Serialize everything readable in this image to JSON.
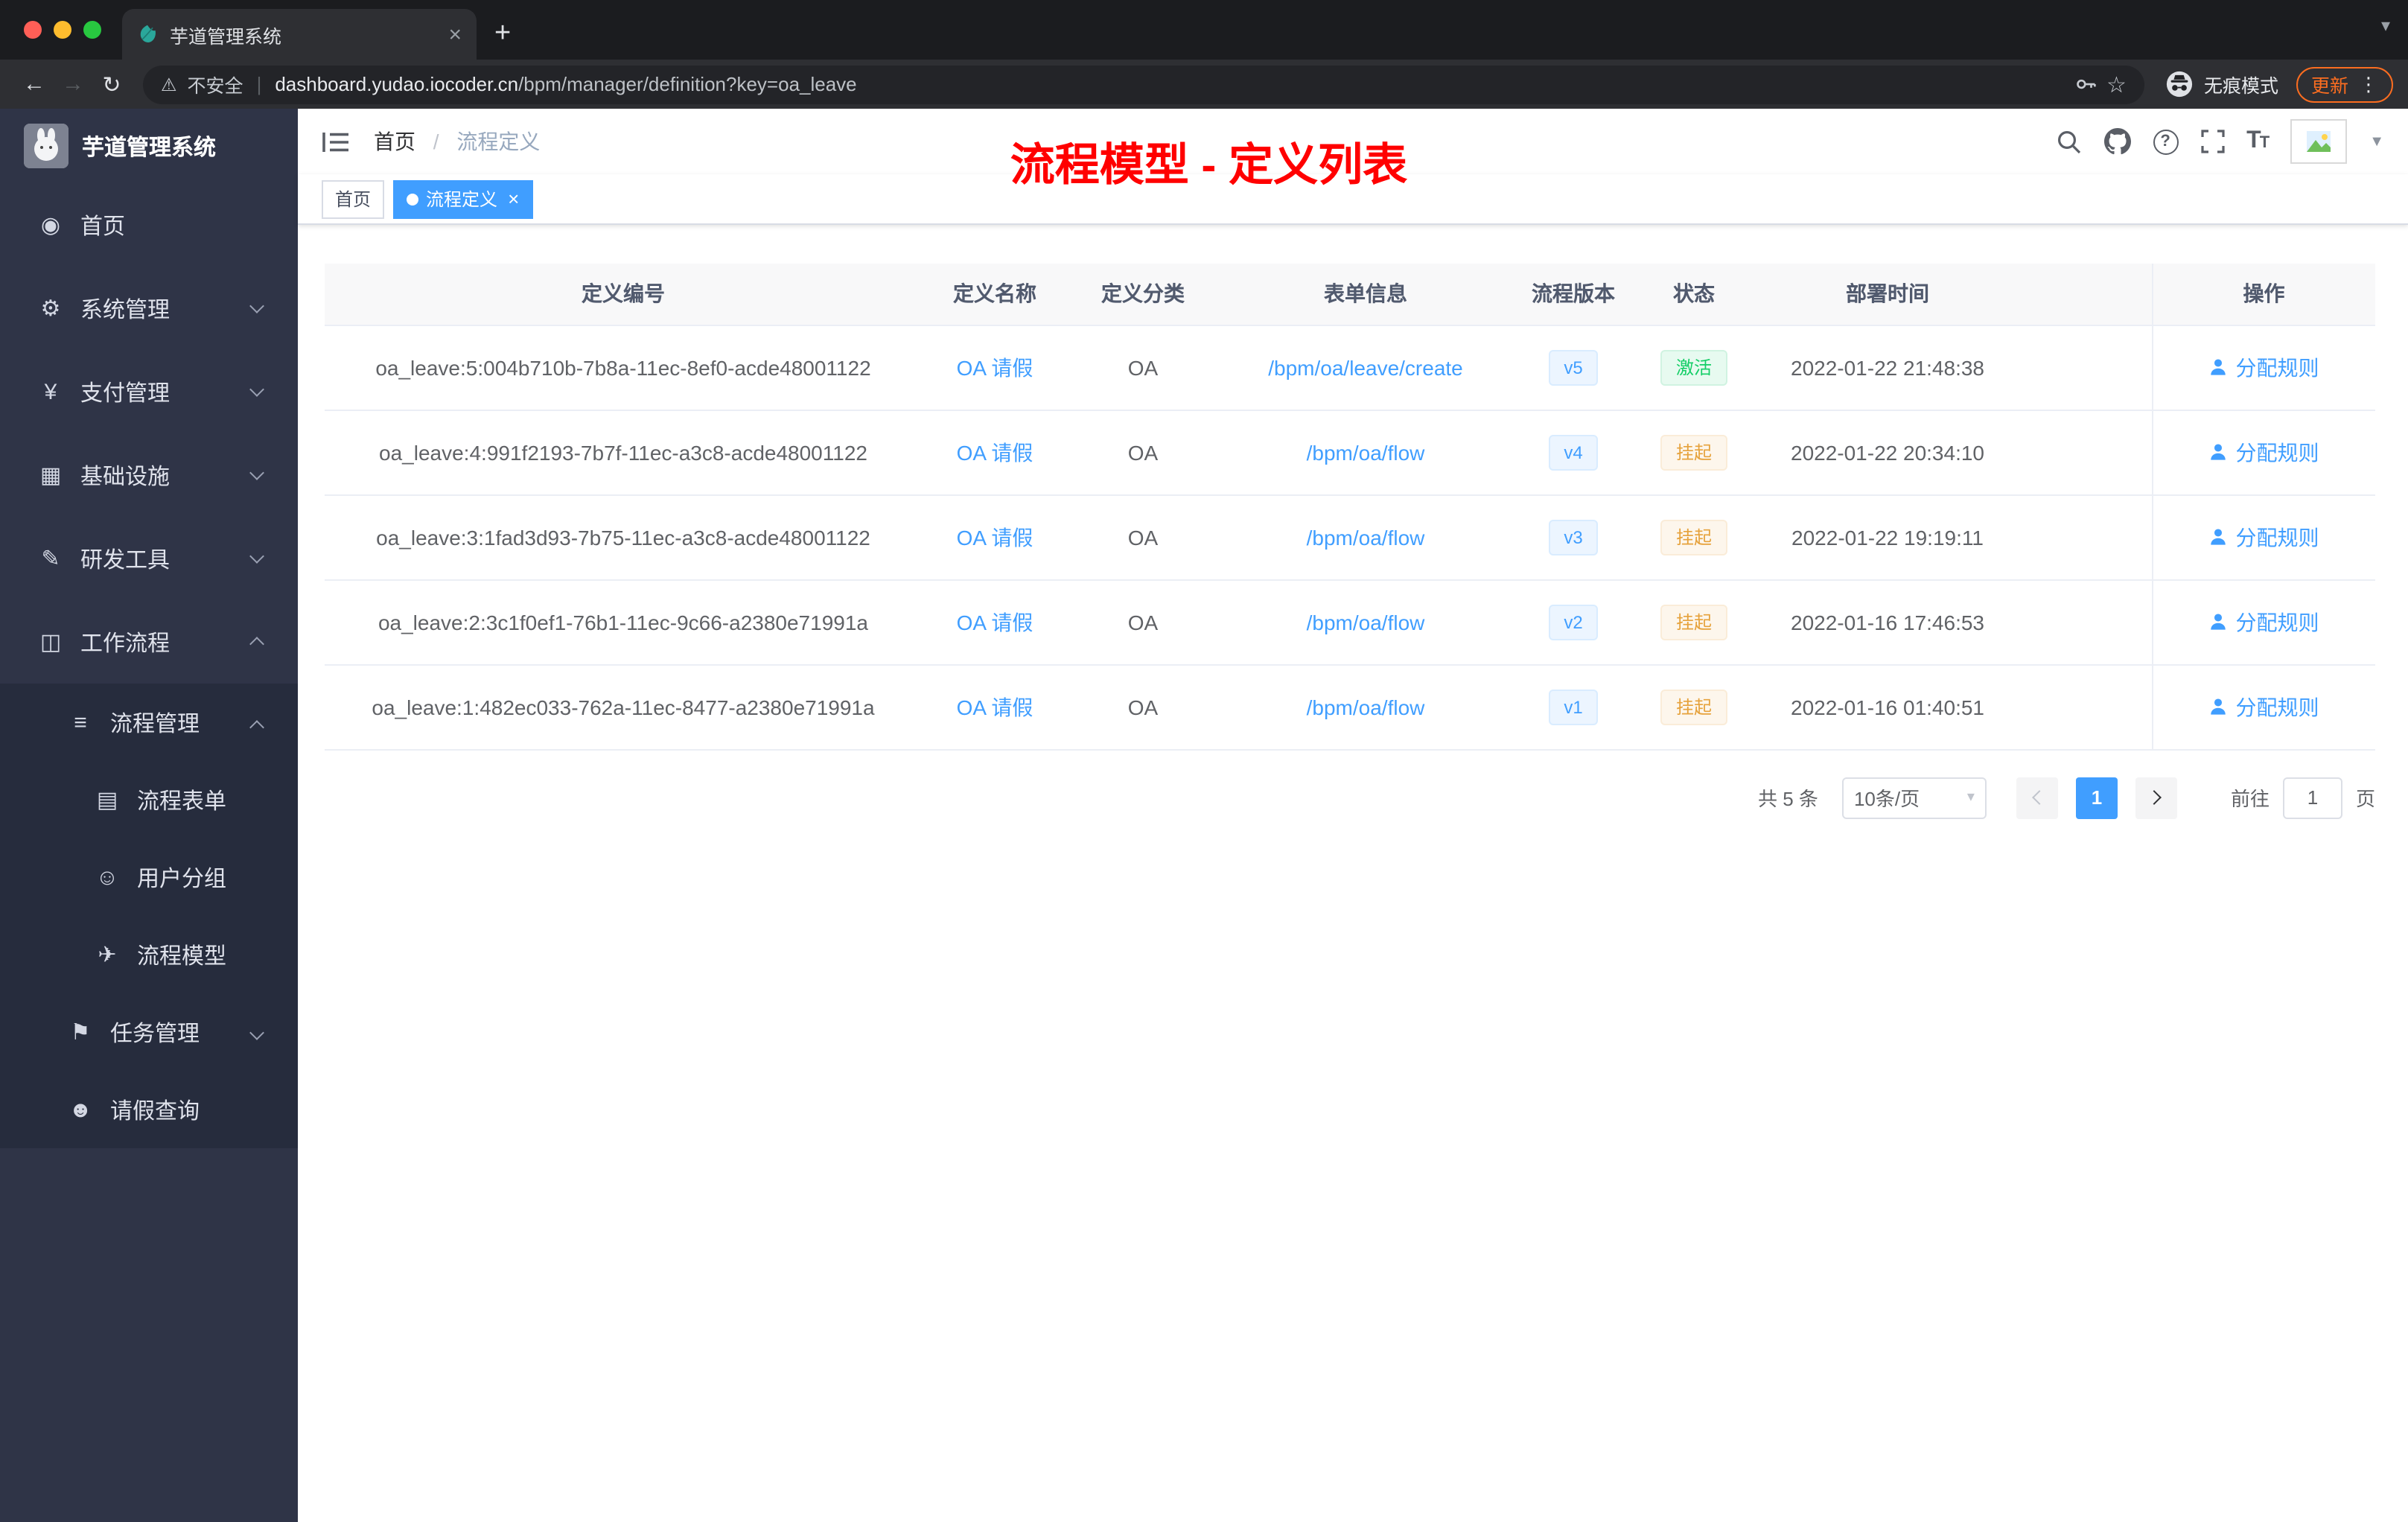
{
  "colors": {
    "accent": "#409eff",
    "success": "#13ce66",
    "warning": "#e6a23c",
    "annotation": "#ff0000",
    "update": "#fb6d20"
  },
  "browser": {
    "tab_title": "芋道管理系统",
    "security_label": "不安全",
    "url_host": "dashboard.yudao.iocoder.cn",
    "url_path": "/bpm/manager/definition?key=oa_leave",
    "incognito_label": "无痕模式",
    "update_label": "更新"
  },
  "sidebar": {
    "logo_title": "芋道管理系统",
    "menu": [
      {
        "id": "home",
        "label": "首页",
        "icon": "dashboard-icon",
        "level": 1,
        "chevron": null,
        "dark": false
      },
      {
        "id": "system-mgmt",
        "label": "系统管理",
        "icon": "gear-icon",
        "level": 1,
        "chevron": "down",
        "dark": false
      },
      {
        "id": "payment-mgmt",
        "label": "支付管理",
        "icon": "yen-icon",
        "level": 1,
        "chevron": "down",
        "dark": false
      },
      {
        "id": "infrastructure",
        "label": "基础设施",
        "icon": "infrastructure-icon",
        "level": 1,
        "chevron": "down",
        "dark": false
      },
      {
        "id": "dev-tools",
        "label": "研发工具",
        "icon": "tools-icon",
        "level": 1,
        "chevron": "down",
        "dark": false
      },
      {
        "id": "workflow",
        "label": "工作流程",
        "icon": "workflow-icon",
        "level": 1,
        "chevron": "up",
        "dark": false
      },
      {
        "id": "process-mgmt",
        "label": "流程管理",
        "icon": "list-icon",
        "level": 2,
        "chevron": "up",
        "dark": true
      },
      {
        "id": "process-form",
        "label": "流程表单",
        "icon": "form-icon",
        "level": 3,
        "chevron": null,
        "dark": true
      },
      {
        "id": "user-group",
        "label": "用户分组",
        "icon": "user-group-icon",
        "level": 3,
        "chevron": null,
        "dark": true
      },
      {
        "id": "process-model",
        "label": "流程模型",
        "icon": "paper-plane-icon",
        "level": 3,
        "chevron": null,
        "dark": true
      },
      {
        "id": "task-mgmt",
        "label": "任务管理",
        "icon": "task-icon",
        "level": 2,
        "chevron": "down",
        "dark": true
      },
      {
        "id": "leave-query",
        "label": "请假查询",
        "icon": "person-icon",
        "level": 2,
        "chevron": null,
        "dark": true
      }
    ]
  },
  "header": {
    "breadcrumb_home": "首页",
    "breadcrumb_separator": "/",
    "breadcrumb_current": "流程定义",
    "annotation": "流程模型 - 定义列表"
  },
  "tags_view": {
    "tags": [
      {
        "label": "首页",
        "active": false,
        "closable": false
      },
      {
        "label": "流程定义",
        "active": true,
        "closable": true
      }
    ]
  },
  "table": {
    "columns": [
      "定义编号",
      "定义名称",
      "定义分类",
      "表单信息",
      "流程版本",
      "状态",
      "部署时间",
      "操作"
    ],
    "rows": [
      {
        "id": "oa_leave:5:004b710b-7b8a-11ec-8ef0-acde48001122",
        "name": "OA 请假",
        "category": "OA",
        "form": "/bpm/oa/leave/create",
        "version": "v5",
        "status": "激活",
        "status_type": "success",
        "deploy_time": "2022-01-22 21:48:38",
        "action": "分配规则"
      },
      {
        "id": "oa_leave:4:991f2193-7b7f-11ec-a3c8-acde48001122",
        "name": "OA 请假",
        "category": "OA",
        "form": "/bpm/oa/flow",
        "version": "v4",
        "status": "挂起",
        "status_type": "warning",
        "deploy_time": "2022-01-22 20:34:10",
        "action": "分配规则"
      },
      {
        "id": "oa_leave:3:1fad3d93-7b75-11ec-a3c8-acde48001122",
        "name": "OA 请假",
        "category": "OA",
        "form": "/bpm/oa/flow",
        "version": "v3",
        "status": "挂起",
        "status_type": "warning",
        "deploy_time": "2022-01-22 19:19:11",
        "action": "分配规则"
      },
      {
        "id": "oa_leave:2:3c1f0ef1-76b1-11ec-9c66-a2380e71991a",
        "name": "OA 请假",
        "category": "OA",
        "form": "/bpm/oa/flow",
        "version": "v2",
        "status": "挂起",
        "status_type": "warning",
        "deploy_time": "2022-01-16 17:46:53",
        "action": "分配规则"
      },
      {
        "id": "oa_leave:1:482ec033-762a-11ec-8477-a2380e71991a",
        "name": "OA 请假",
        "category": "OA",
        "form": "/bpm/oa/flow",
        "version": "v1",
        "status": "挂起",
        "status_type": "warning",
        "deploy_time": "2022-01-16 01:40:51",
        "action": "分配规则"
      }
    ]
  },
  "pagination": {
    "total_text": "共 5 条",
    "page_size": "10条/页",
    "current_page": "1",
    "goto_prefix": "前往",
    "goto_value": "1",
    "goto_suffix": "页"
  }
}
